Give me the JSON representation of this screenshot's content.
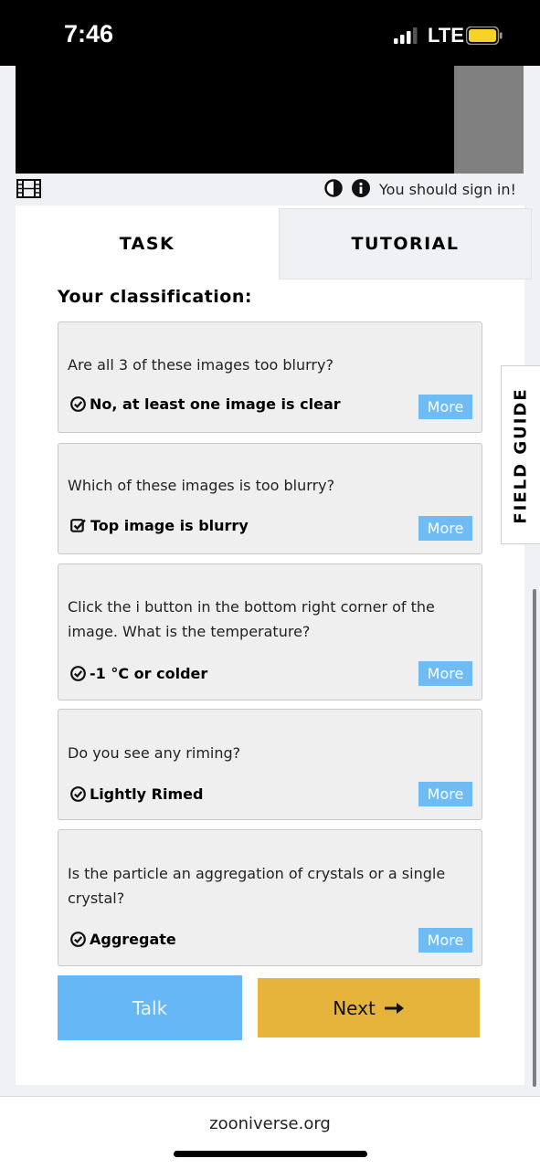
{
  "status_bar": {
    "time": "7:46",
    "network": "LTE",
    "signal_icon": "signal-bars-icon",
    "battery_icon": "battery-icon",
    "battery_color": "#f5d328"
  },
  "viewer": {
    "film_icon": "film-icon",
    "contrast_icon": "contrast-icon",
    "info_icon": "info-icon",
    "sign_in_text": "You should sign in!"
  },
  "tabs": [
    {
      "label": "TASK",
      "active": true
    },
    {
      "label": "TUTORIAL",
      "active": false
    }
  ],
  "classification": {
    "heading": "Your classification:",
    "cards": [
      {
        "question": "Are all 3 of these images too blurry?",
        "answer": "No, at least one image is clear",
        "answer_icon": "check-circle-icon",
        "more_label": "More"
      },
      {
        "question": "Which of these images is too blurry?",
        "answer": "Top image is blurry",
        "answer_icon": "check-square-icon",
        "more_label": "More"
      },
      {
        "question": "Click the i button in the bottom right corner of the image. What is the temperature?",
        "answer": "-1 °C or colder",
        "answer_icon": "check-circle-icon",
        "more_label": "More"
      },
      {
        "question": "Do you see any riming?",
        "answer": "Lightly Rimed",
        "answer_icon": "check-circle-icon",
        "more_label": "More"
      },
      {
        "question": "Is the particle an aggregation of crystals or a single crystal?",
        "answer": "Aggregate",
        "answer_icon": "check-circle-icon",
        "more_label": "More"
      }
    ]
  },
  "actions": {
    "talk_label": "Talk",
    "next_label": "Next",
    "next_icon": "arrow-right-icon"
  },
  "field_guide": {
    "label": "FIELD GUIDE"
  },
  "browser": {
    "url": "zooniverse.org"
  },
  "colors": {
    "more_button": "#6fbcf5",
    "talk_button": "#65b8f5",
    "next_button": "#e6b33b"
  }
}
